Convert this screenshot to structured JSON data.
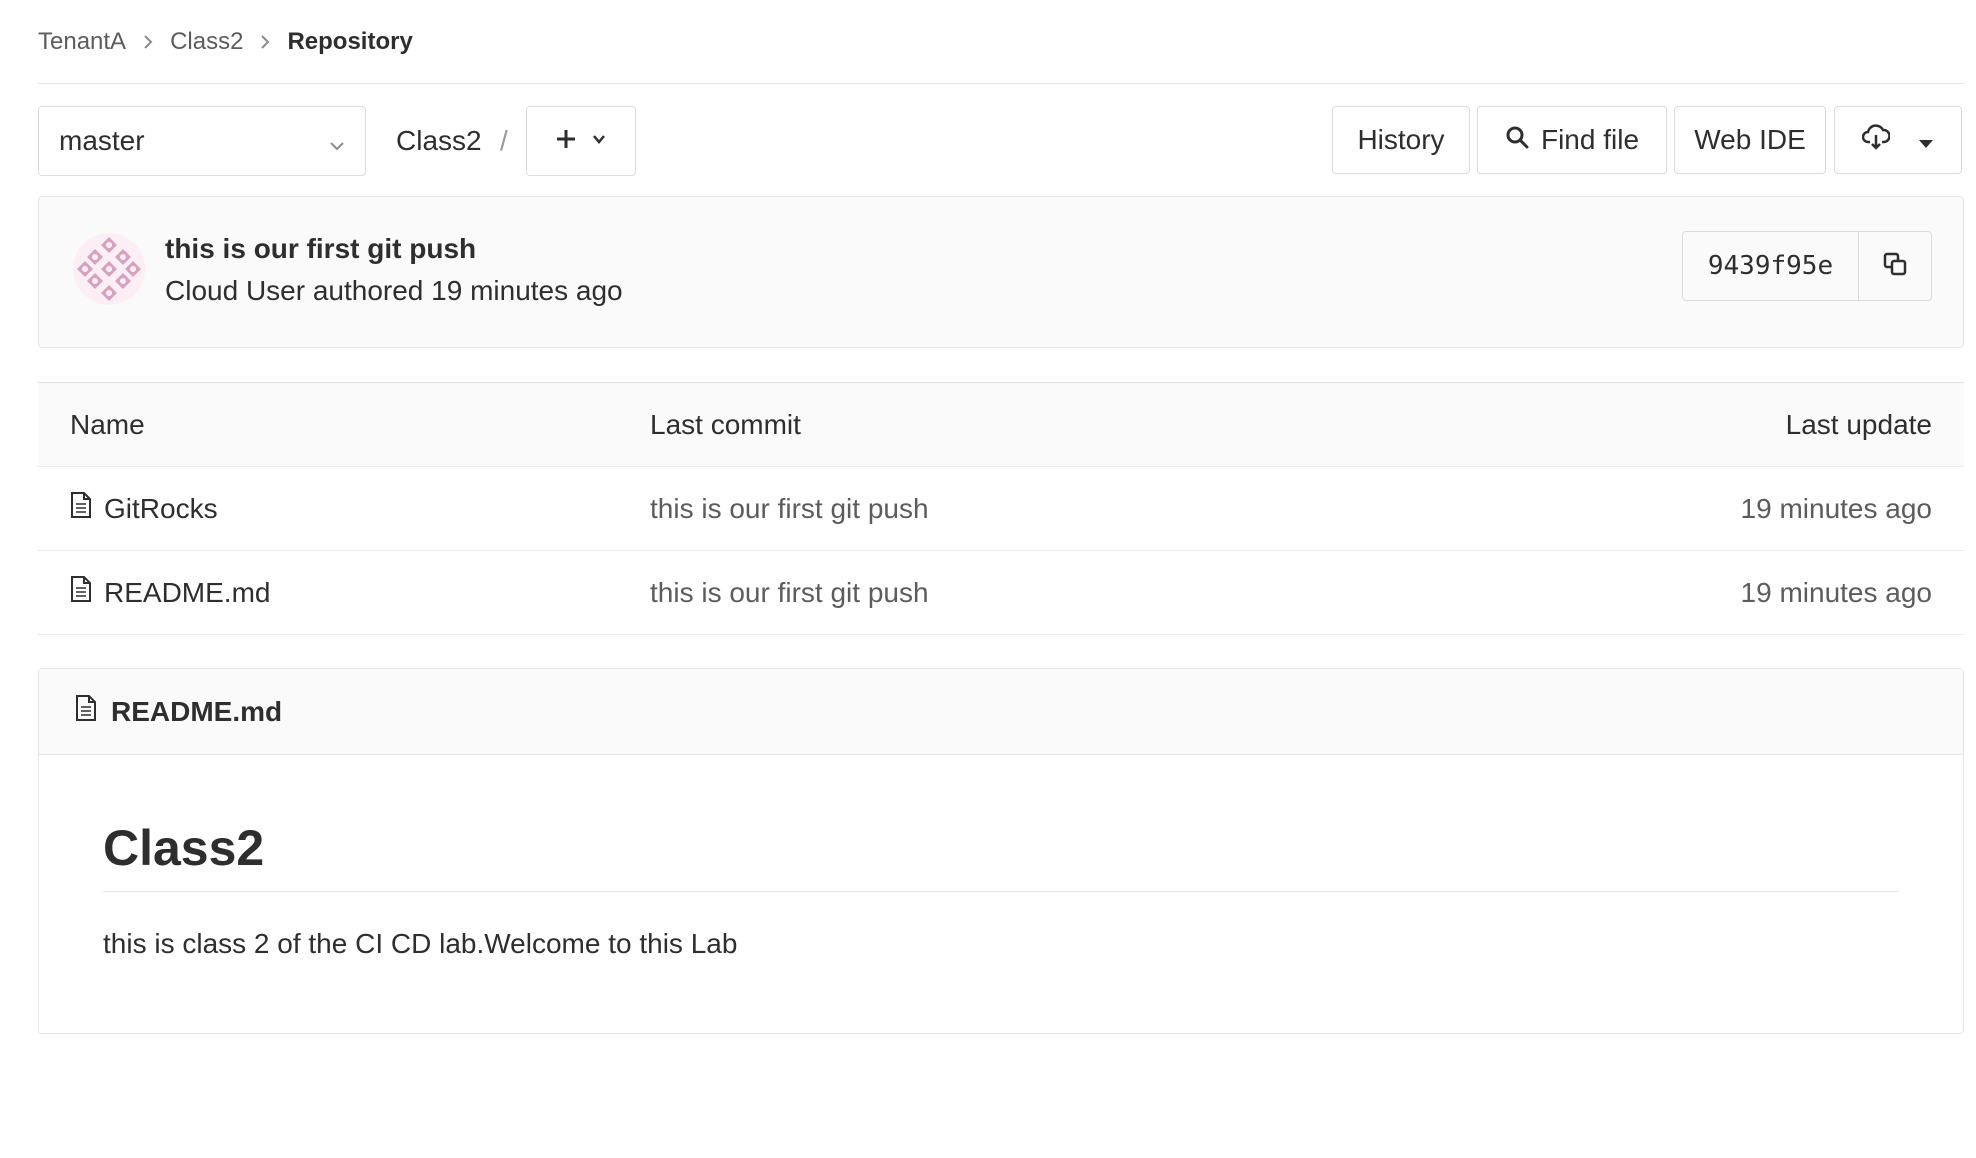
{
  "breadcrumb": {
    "items": [
      "TenantA",
      "Class2",
      "Repository"
    ]
  },
  "nav": {
    "branch": "master",
    "path": "Class2",
    "path_separator": "/",
    "buttons": {
      "history": "History",
      "find_file": "Find file",
      "web_ide": "Web IDE"
    }
  },
  "commit": {
    "title": "this is our first git push",
    "meta": "Cloud User authored 19 minutes ago",
    "sha": "9439f95e"
  },
  "table": {
    "headers": {
      "name": "Name",
      "last_commit": "Last commit",
      "last_update": "Last update"
    },
    "rows": [
      {
        "name": "GitRocks",
        "last_commit": "this is our first git push",
        "last_update": "19 minutes ago"
      },
      {
        "name": "README.md",
        "last_commit": "this is our first git push",
        "last_update": "19 minutes ago"
      }
    ]
  },
  "readme": {
    "filename": "README.md",
    "heading": "Class2",
    "body": "this is class 2 of the CI CD lab.Welcome to this Lab"
  },
  "colors": {
    "text": "#2e2e2e",
    "muted": "#5c5c5c",
    "border": "#e5e5e5",
    "panel": "#fafafa",
    "avatar": "#d7a2bd"
  },
  "icons": [
    "chevron-right-icon",
    "chevron-down-icon",
    "plus-icon",
    "search-icon",
    "download-icon",
    "caret-down-icon",
    "copy-icon",
    "file-icon"
  ]
}
